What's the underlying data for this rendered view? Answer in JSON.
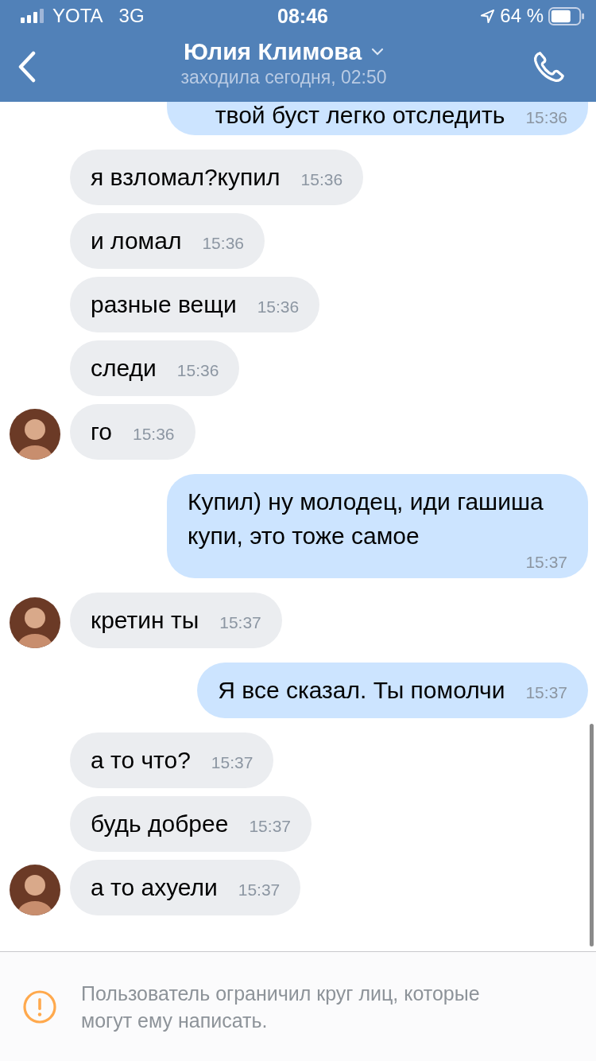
{
  "status_bar": {
    "carrier": "YOTA",
    "network": "3G",
    "time": "08:46",
    "battery": "64 %"
  },
  "header": {
    "title": "Юлия Климова",
    "subtitle": "заходила сегодня, 02:50"
  },
  "messages": [
    {
      "kind": "out",
      "text": "твой буст легко отследить",
      "time": "15:36"
    },
    {
      "kind": "in",
      "text": "я взломал?купил",
      "time": "15:36",
      "avatar": false
    },
    {
      "kind": "in",
      "text": "и ломал",
      "time": "15:36",
      "avatar": false
    },
    {
      "kind": "in",
      "text": "разные вещи",
      "time": "15:36",
      "avatar": false
    },
    {
      "kind": "in",
      "text": "следи",
      "time": "15:36",
      "avatar": false
    },
    {
      "kind": "in",
      "text": "го",
      "time": "15:36",
      "avatar": true
    },
    {
      "kind": "out",
      "text": "Купил) ну молодец, иди гашиша купи, это тоже самое",
      "time": "15:37"
    },
    {
      "kind": "in",
      "text": "кретин ты",
      "time": "15:37",
      "avatar": true
    },
    {
      "kind": "out",
      "text": "Я все сказал. Ты помолчи",
      "time": "15:37"
    },
    {
      "kind": "in",
      "text": "а то что?",
      "time": "15:37",
      "avatar": false
    },
    {
      "kind": "in",
      "text": "будь добрее",
      "time": "15:37",
      "avatar": false
    },
    {
      "kind": "in",
      "text": "а то ахуели",
      "time": "15:37",
      "avatar": true
    }
  ],
  "notice": "Пользователь ограничил круг лиц, которые могут ему написать."
}
